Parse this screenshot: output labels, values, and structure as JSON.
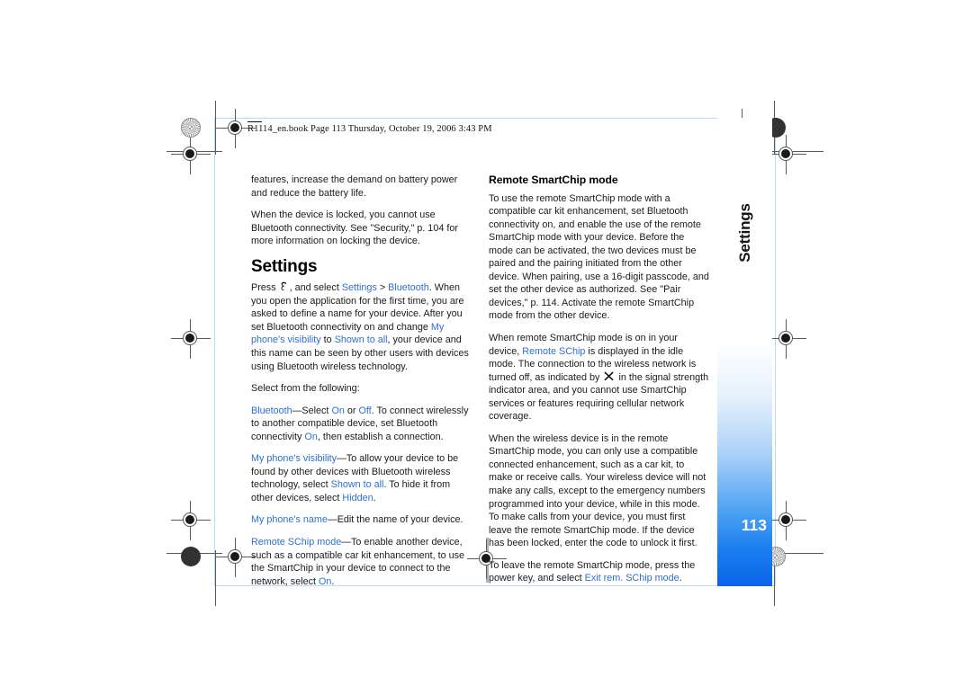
{
  "document": {
    "book_header": "R1114_en.book  Page 113  Thursday, October 19, 2006  3:43 PM"
  },
  "side_tab": {
    "label": "Settings",
    "page_number": "113",
    "accent_color": "#0a63e8",
    "link_color": "#2f6fd0"
  },
  "left_column": {
    "para_continued": "features, increase the demand on battery power and reduce the battery life.",
    "para_locked_pre": "When the device is locked, you cannot use Bluetooth connectivity. See \"Security,\" p. 104 for more information on locking the device.",
    "section_title": "Settings",
    "press_pre": "Press",
    "press_mid": ", and select ",
    "press_link_settings": "Settings",
    "press_gt": " > ",
    "press_link_bluetooth": "Bluetooth",
    "press_post": ". When you open the application for the first time, you are asked to define a name for your device. After you set Bluetooth connectivity on and change ",
    "press_link_visibility": "My phone's visibility",
    "press_post2": " to ",
    "press_link_shown": "Shown to all",
    "press_post3": ", your device and this name can be seen by other users with devices using Bluetooth wireless technology.",
    "select_following": "Select from the following:",
    "item_bluetooth_term": "Bluetooth",
    "item_bluetooth_a": "—Select ",
    "item_bluetooth_on": "On",
    "item_bluetooth_b": " or ",
    "item_bluetooth_off": "Off",
    "item_bluetooth_c": ". To connect wirelessly to another compatible device, set Bluetooth connectivity ",
    "item_bluetooth_on2": "On",
    "item_bluetooth_d": ", then establish a connection.",
    "item_visibility_term": "My phone's visibility",
    "item_visibility_a": "—To allow your device to be found by other devices with Bluetooth wireless technology, select ",
    "item_visibility_shown": "Shown to all",
    "item_visibility_b": ". To hide it from other devices, select ",
    "item_visibility_hidden": "Hidden",
    "item_visibility_c": ".",
    "item_name_term": "My phone's name",
    "item_name_a": "—Edit the name of your device.",
    "item_schip_term": "Remote SChip mode",
    "item_schip_a": "—To enable another device, such as a compatible car kit enhancement, to use the SmartChip in your device to connect to the network, select ",
    "item_schip_on": "On",
    "item_schip_b": "."
  },
  "right_column": {
    "sub_title": "Remote SmartChip mode",
    "para_1": "To use the remote SmartChip mode with a compatible car kit enhancement, set Bluetooth connectivity on, and enable the use of the remote SmartChip mode with your device. Before the mode can be activated, the two devices must be paired and the pairing initiated from the other device. When pairing, use a 16-digit passcode, and set the other device as authorized. See \"Pair devices,\" p. 114. Activate the remote SmartChip mode from the other device.",
    "para_2_a": "When remote SmartChip mode is on in your device, ",
    "para_2_link": "Remote SChip",
    "para_2_b": " is displayed in the idle mode. The connection to the wireless network is turned off, as indicated by ",
    "para_2_c": " in the signal strength indicator area, and you cannot use SmartChip services or features requiring cellular network coverage.",
    "para_3": "When the wireless device is in the remote SmartChip mode, you can only use a compatible connected enhancement, such as a car kit, to make or receive calls. Your wireless device will not make any calls, except to the emergency numbers programmed into your device, while in this mode. To make calls from your device, you must first leave the remote SmartChip mode. If the device has been locked, enter the code to unlock it first.",
    "para_4_a": "To leave the remote SmartChip mode, press the power key, and select ",
    "para_4_link": "Exit rem. SChip mode",
    "para_4_b": "."
  },
  "icons": {
    "menu_key": "menu-key-icon",
    "no_network": "no-network-x-icon",
    "registration": "registration-target-icon",
    "star_target": "star-target-icon"
  }
}
